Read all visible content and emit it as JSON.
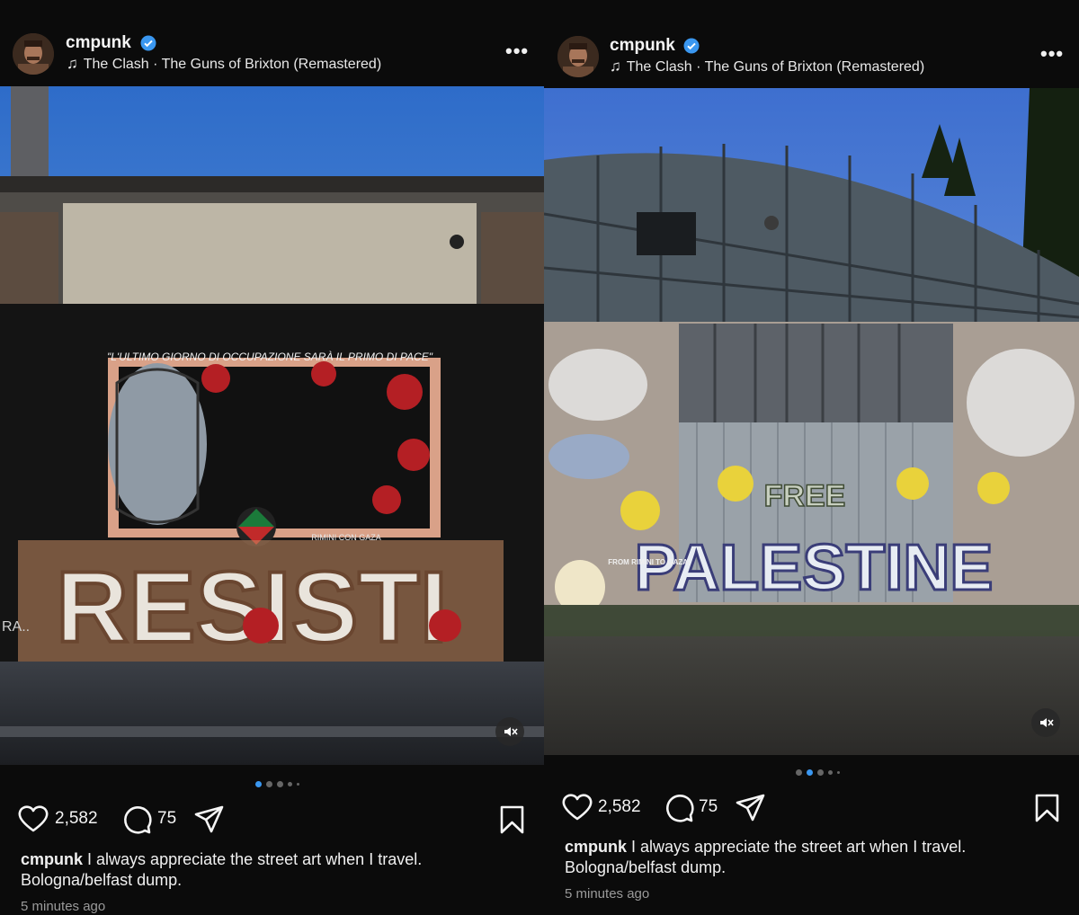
{
  "posts": [
    {
      "username": "cmpunk",
      "song": "The Clash · The Guns of Brixton (Remastered)",
      "likes": "2,582",
      "comments": "75",
      "caption_line1": "I always appreciate the street art when I travel.",
      "caption_line2": "Bologna/belfast dump.",
      "time": "5 minutes ago",
      "mural_text": "RESISTI",
      "mural_quote": "\"L'ULTIMO GIORNO DI OCCUPAZIONE SARÀ IL PRIMO DI PACE\"",
      "mural_small": "RIMINI CON GAZA",
      "mural_corner": "RA..",
      "carousel": {
        "current": 1,
        "total": 5
      }
    },
    {
      "username": "cmpunk",
      "song": "The Clash · The Guns of Brixton (Remastered)",
      "likes": "2,582",
      "comments": "75",
      "caption_line1": "I always appreciate the street art when I travel.",
      "caption_line2": "Bologna/belfast dump.",
      "time": "5 minutes ago",
      "mural_text": "PALESTINE",
      "mural_free": "FREE",
      "mural_small": "FROM RIMINI TO GAZA!",
      "carousel": {
        "current": 2,
        "total": 5
      }
    }
  ],
  "icons": [
    "avatar",
    "verified-badge-icon",
    "music-note-icon",
    "more-options-icon",
    "heart-icon",
    "comment-icon",
    "share-icon",
    "bookmark-icon",
    "mute-icon"
  ],
  "colors": {
    "verified": "#3a97f0",
    "background": "#0b0b0b",
    "dot_active": "#3a97f0"
  }
}
